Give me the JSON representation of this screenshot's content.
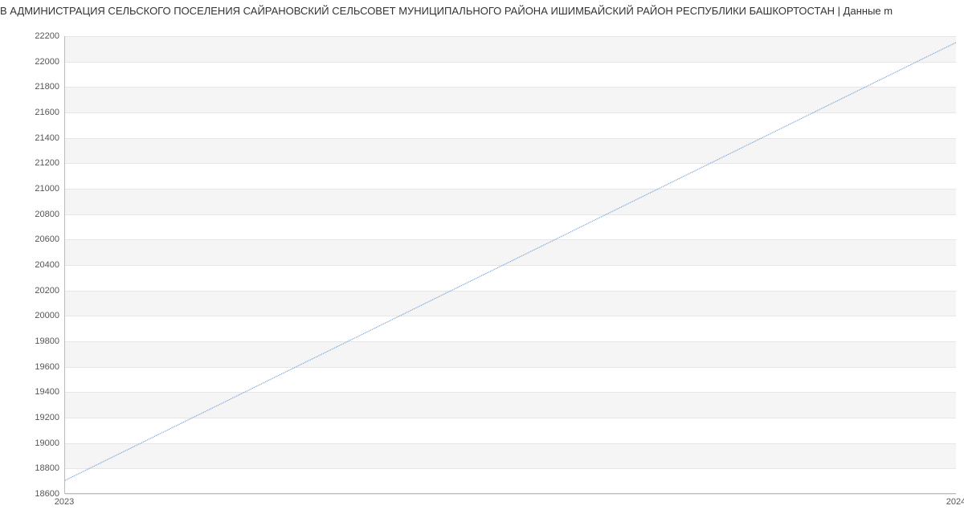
{
  "chart_data": {
    "type": "line",
    "title": "В АДМИНИСТРАЦИЯ СЕЛЬСКОГО ПОСЕЛЕНИЯ САЙРАНОВСКИЙ СЕЛЬСОВЕТ МУНИЦИПАЛЬНОГО РАЙОНА ИШИМБАЙСКИЙ РАЙОН РЕСПУБЛИКИ БАШКОРТОСТАН | Данные m",
    "x": [
      2023,
      2024
    ],
    "values": [
      18700,
      22150
    ],
    "xlabel": "",
    "ylabel": "",
    "xlim": [
      2023,
      2024
    ],
    "ylim": [
      18600,
      22200
    ],
    "y_ticks": [
      18600,
      18800,
      19000,
      19200,
      19400,
      19600,
      19800,
      20000,
      20200,
      20400,
      20600,
      20800,
      21000,
      21200,
      21400,
      21600,
      21800,
      22000,
      22200
    ],
    "x_ticks": [
      2023,
      2024
    ],
    "line_color": "#6b9bd1",
    "band_color": "#f5f5f5"
  }
}
